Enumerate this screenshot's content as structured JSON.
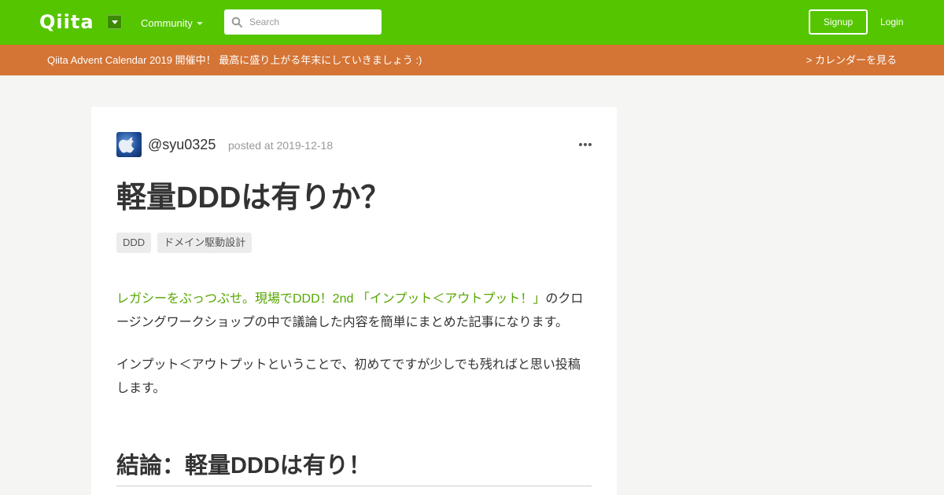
{
  "header": {
    "logo": "Qiita",
    "community_label": "Community",
    "search_placeholder": "Search",
    "signup_label": "Signup",
    "login_label": "Login"
  },
  "banner": {
    "text": "Qiita Advent Calendar 2019 開催中！ 最高に盛り上がる年末にしていきましょう :)",
    "link": "> カレンダーを見る"
  },
  "article": {
    "author": "@syu0325",
    "posted": "posted at 2019-12-18",
    "title": "軽量DDDは有りか？",
    "tags": [
      "DDD",
      "ドメイン駆動設計"
    ],
    "para1_link": "レガシーをぶっつぶせ。現場でDDD！2nd 「インプット＜アウトプット！」",
    "para1_rest": "のクロージングワークショップの中で議論した内容を簡単にまとめた記事になります。",
    "para2": "インプット＜アウトプットということで、初めてですが少しでも残ればと思い投稿します。",
    "heading": "結論：軽量DDDは有り！"
  },
  "colors": {
    "header_bg": "#55c500",
    "banner_bg": "#d47435",
    "link": "#55a600",
    "page_bg": "#f5f5f3"
  },
  "icons": {
    "search": "search-icon",
    "dropdown": "chevron-down-icon",
    "more": "more-options-icon"
  }
}
